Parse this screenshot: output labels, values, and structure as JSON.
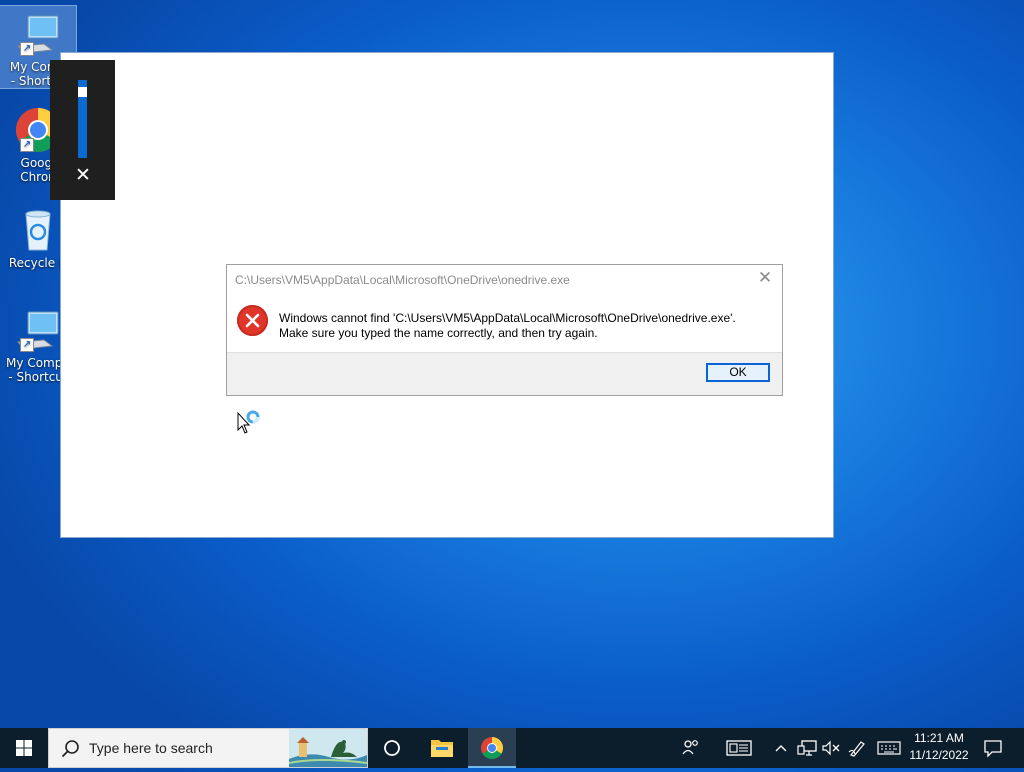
{
  "desktop": {
    "icons": [
      {
        "label": "My Comp\n- Shortcu",
        "name": "my-computer-shortcut-1"
      },
      {
        "label": "Googl\nChron",
        "name": "google-chrome"
      },
      {
        "label": "Recycle B",
        "name": "recycle-bin"
      },
      {
        "label": "My Compu\n- Shortcut",
        "name": "my-computer-shortcut-2"
      }
    ]
  },
  "volume_flyout": {
    "level": 0.9,
    "close_glyph": "✕"
  },
  "dialog": {
    "title": "C:\\Users\\VM5\\AppData\\Local\\Microsoft\\OneDrive\\onedrive.exe",
    "message_line1": "Windows cannot find 'C:\\Users\\VM5\\AppData\\Local\\Microsoft\\OneDrive\\onedrive.exe'.",
    "message_line2": "Make sure you typed the name correctly, and then try again.",
    "ok_label": "OK",
    "close_glyph": "✕",
    "icon": "error-icon"
  },
  "taskbar": {
    "search_placeholder": "Type here to search",
    "apps": [
      "task-view",
      "file-explorer",
      "google-chrome"
    ],
    "active_app": "google-chrome",
    "tray_icons": [
      "people-icon",
      "news-icon",
      "chevron-up-icon",
      "network-icon",
      "volume-muted-icon",
      "pen-icon",
      "keyboard-icon"
    ],
    "clock": {
      "time": "11:21 AM",
      "date": "11/12/2022"
    },
    "notification_icon": "notification-icon"
  },
  "colors": {
    "taskbar_bg": "#0c1d2c",
    "accent": "#0a64d6",
    "error_red": "#e0362a"
  }
}
